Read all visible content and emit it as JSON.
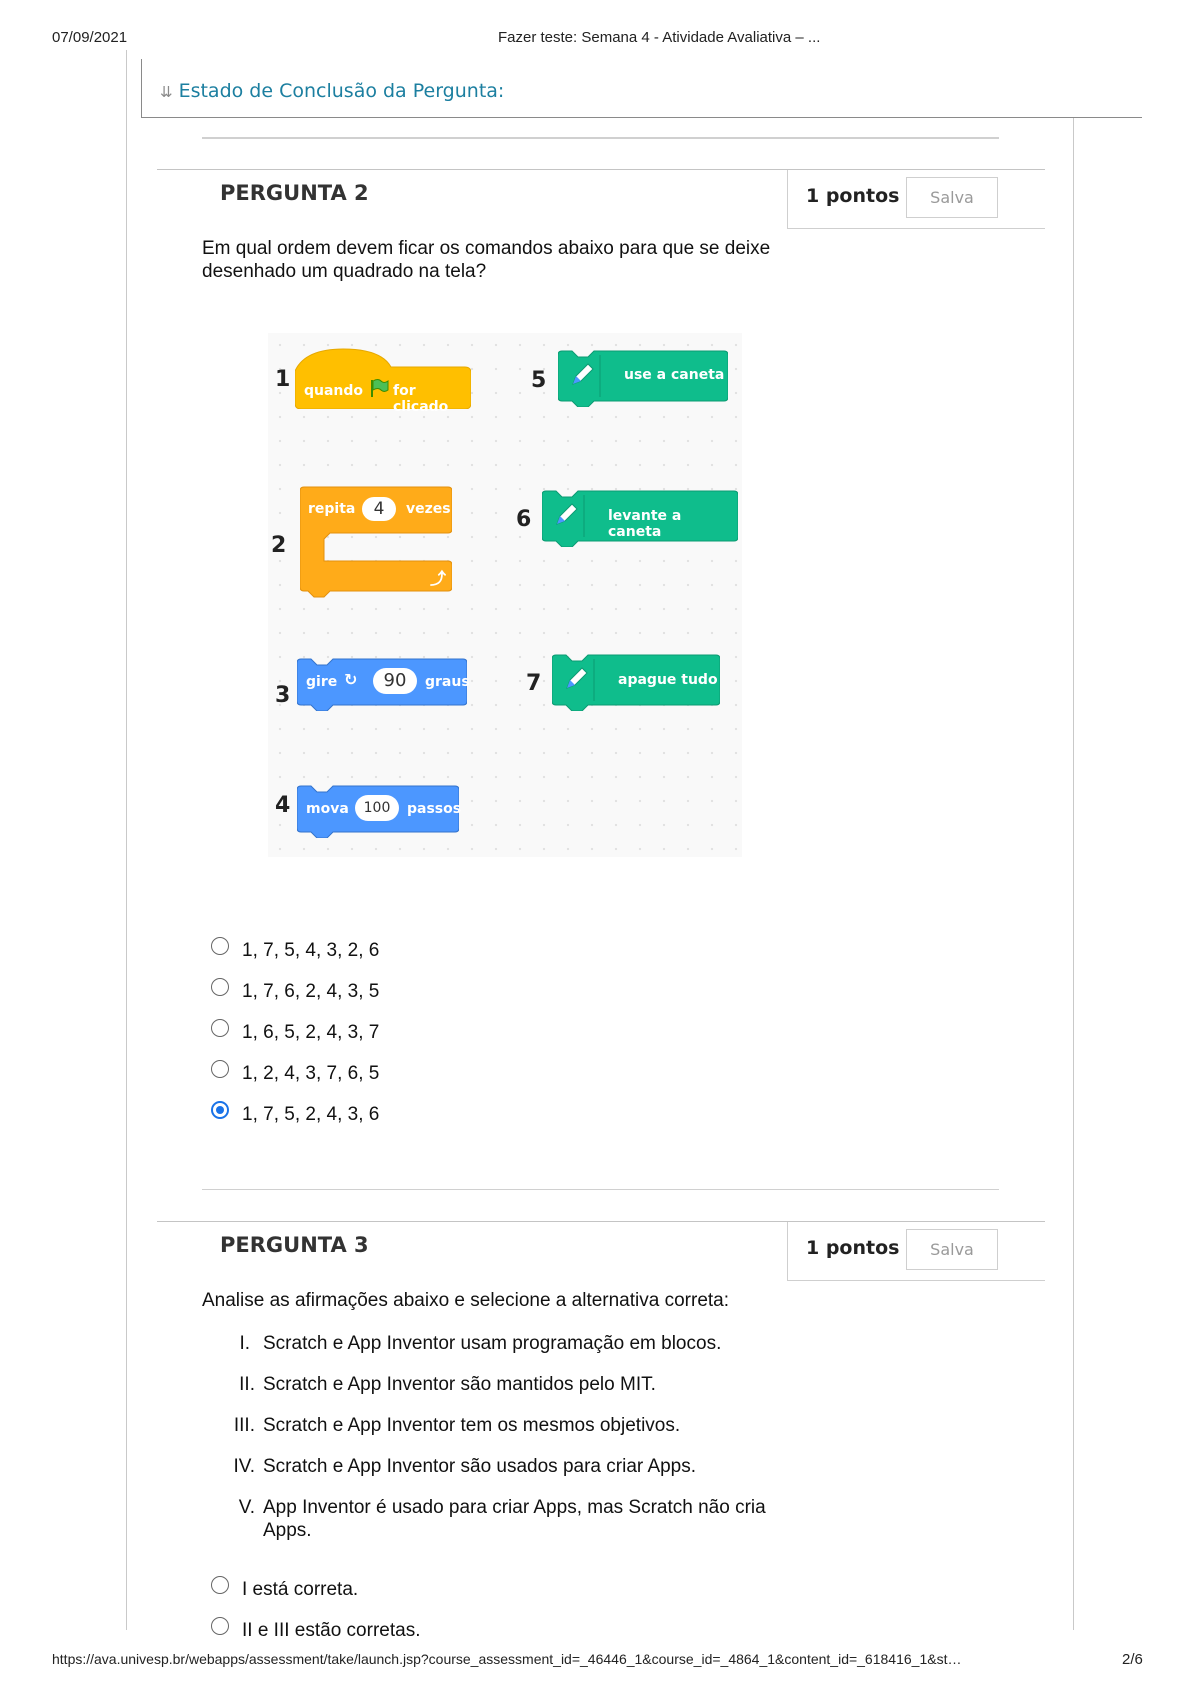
{
  "print": {
    "date": "07/09/2021",
    "title": "Fazer teste: Semana 4 - Atividade Avaliativa – ...",
    "url": "https://ava.univesp.br/webapps/assessment/take/launch.jsp?course_assessment_id=_46446_1&course_id=_4864_1&content_id=_618416_1&st…",
    "page": "2/6"
  },
  "completion": {
    "label": "Estado de Conclusão da Pergunta:",
    "icon": "double-chevron-down-icon"
  },
  "q2": {
    "title": "PERGUNTA 2",
    "points": "1 pontos",
    "save": "Salva",
    "text_line1": "Em qual ordem devem ficar os comandos abaixo para que se deixe",
    "text_line2": "desenhado um quadrado na tela?",
    "figure": {
      "blocks": [
        {
          "num": "1",
          "a": "quando",
          "b": "for clicado",
          "color": "#ffbf00"
        },
        {
          "num": "2",
          "a": "repita",
          "val": "4",
          "b": "vezes",
          "color": "#ffab19"
        },
        {
          "num": "3",
          "a": "gire",
          "val": "90",
          "b": "graus",
          "color": "#4c97ff"
        },
        {
          "num": "4",
          "a": "mova",
          "val": "100",
          "b": "passos",
          "color": "#4c97ff"
        },
        {
          "num": "5",
          "label": "use a caneta",
          "color": "#0fbd8c"
        },
        {
          "num": "6",
          "label": "levante a caneta",
          "color": "#0fbd8c"
        },
        {
          "num": "7",
          "label": "apague tudo",
          "color": "#0fbd8c"
        }
      ]
    },
    "options": [
      {
        "label": "1, 7, 5, 4, 3, 2, 6",
        "selected": false
      },
      {
        "label": "1, 7, 6, 2, 4, 3, 5",
        "selected": false
      },
      {
        "label": "1, 6, 5, 2, 4, 3, 7",
        "selected": false
      },
      {
        "label": "1, 2, 4, 3, 7, 6, 5",
        "selected": false
      },
      {
        "label": "1, 7, 5, 2, 4, 3, 6",
        "selected": true
      }
    ]
  },
  "q3": {
    "title": "PERGUNTA 3",
    "points": "1 pontos",
    "save": "Salva",
    "text": "Analise as afirmações abaixo e selecione a alternativa correta:",
    "statements": [
      {
        "num": "I.",
        "text": "Scratch e App Inventor usam programação em blocos."
      },
      {
        "num": "II.",
        "text": "Scratch e App Inventor são mantidos pelo MIT."
      },
      {
        "num": "III.",
        "text": "Scratch e App Inventor tem os mesmos objetivos."
      },
      {
        "num": "IV.",
        "text": "Scratch e App Inventor são usados para criar Apps."
      },
      {
        "num": "V.",
        "text": "App Inventor é usado para criar Apps, mas Scratch não cria",
        "text2": "Apps."
      }
    ],
    "options": [
      {
        "label": "I está correta.",
        "selected": false
      },
      {
        "label": "II e III estão corretas.",
        "selected": false
      }
    ]
  }
}
